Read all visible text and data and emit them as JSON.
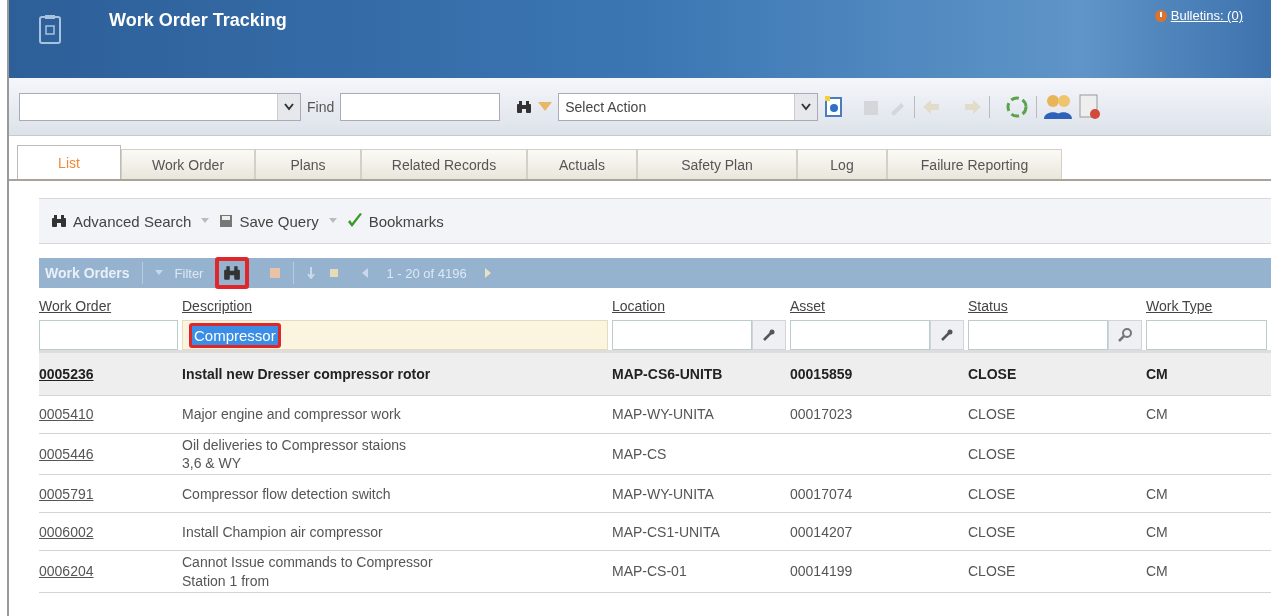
{
  "app": {
    "title": "Work Order Tracking",
    "bulletins": "Bulletins: (0)"
  },
  "toolbar": {
    "find_label": "Find",
    "action_select": "Select Action"
  },
  "tabs": [
    {
      "label": "List",
      "selected": true
    },
    {
      "label": "Work Order",
      "selected": false
    },
    {
      "label": "Plans",
      "selected": false
    },
    {
      "label": "Related Records",
      "selected": false
    },
    {
      "label": "Actuals",
      "selected": false
    },
    {
      "label": "Safety Plan",
      "selected": false
    },
    {
      "label": "Log",
      "selected": false
    },
    {
      "label": "Failure Reporting",
      "selected": false
    }
  ],
  "query_bar": [
    {
      "kind": "search",
      "label": "Advanced Search",
      "menu": true
    },
    {
      "kind": "save",
      "label": "Save Query",
      "menu": true
    },
    {
      "kind": "bookmark",
      "label": "Bookmarks",
      "menu": false
    }
  ],
  "table": {
    "title": "Work Orders",
    "filter_label": "Filter",
    "range": "1 - 20 of 4196",
    "filter_icon_highlighted": true,
    "columns": [
      {
        "label": "Work Order",
        "kind": "plain"
      },
      {
        "label": "Description",
        "filter": "Compressor",
        "kind": "plain",
        "highlighted": true
      },
      {
        "label": "Location",
        "kind": "wrench"
      },
      {
        "label": "Asset",
        "kind": "wrench"
      },
      {
        "label": "Status",
        "kind": "search"
      },
      {
        "label": "Work Type",
        "kind": "plain"
      }
    ],
    "rows": [
      {
        "selected": true,
        "cells": [
          "0005236",
          "Install new Dresser compressor rotor",
          "MAP-CS6-UNITB",
          "00015859",
          "CLOSE",
          "CM"
        ]
      },
      {
        "selected": false,
        "cells": [
          "0005410",
          "Major engine and compressor work",
          "MAP-WY-UNITA",
          "00017023",
          "CLOSE",
          "CM"
        ]
      },
      {
        "selected": false,
        "cells": [
          "0005446",
          "Oil deliveries to Compressor staions\n3,6 & WY",
          "MAP-CS",
          "",
          "CLOSE",
          ""
        ]
      },
      {
        "selected": false,
        "cells": [
          "0005791",
          "Compressor flow detection switch",
          "MAP-WY-UNITA",
          "00017074",
          "CLOSE",
          "CM"
        ]
      },
      {
        "selected": false,
        "cells": [
          "0006002",
          "Install Champion air compressor",
          "MAP-CS1-UNITA",
          "00014207",
          "CLOSE",
          "CM"
        ]
      },
      {
        "selected": false,
        "cells": [
          "0006204",
          "Cannot Issue commands to Compressor\nStation 1 from",
          "MAP-CS-01",
          "00014199",
          "CLOSE",
          "CM"
        ]
      }
    ]
  }
}
